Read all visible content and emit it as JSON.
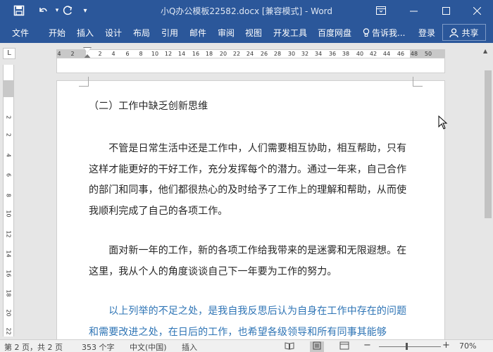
{
  "window": {
    "title": "小Q办公模板22582.docx [兼容模式] - Word",
    "minimize_icon": "minimize-icon",
    "restore_icon": "restore-icon",
    "close_icon": "close-icon"
  },
  "quick_access": {
    "save_icon": "save-icon",
    "undo_icon": "undo-icon",
    "redo_icon": "redo-icon",
    "customize_icon": "customize-toolbar-icon"
  },
  "ribbon": {
    "tabs": [
      "文件",
      "开始",
      "插入",
      "设计",
      "布局",
      "引用",
      "邮件",
      "审阅",
      "视图",
      "开发工具",
      "百度网盘"
    ],
    "tell_me": "告诉我...",
    "login": "登录",
    "share": "共享"
  },
  "ruler": {
    "tab_selector": "L",
    "numbers": [
      "4",
      "2",
      "2",
      "4",
      "6",
      "8",
      "10",
      "12",
      "14",
      "16",
      "18",
      "20",
      "22",
      "24",
      "26",
      "28",
      "30",
      "32",
      "34",
      "36",
      "38",
      "40",
      "42",
      "44",
      "46",
      "48",
      "50"
    ],
    "vertical_numbers": [
      "2",
      "2",
      "4",
      "6",
      "8",
      "10",
      "12",
      "14",
      "16",
      "18",
      "20",
      "22"
    ]
  },
  "document": {
    "heading": "（二）工作中缺乏创新思维",
    "paragraph1": "　　不管是日常生活中还是工作中，人们需要相互协助，相互帮助，只有这样才能更好的干好工作，充分发挥每个的潜力。通过一年来，自己合作的部门和同事，他们都很热心的及时给予了工作上的理解和帮助，从而使我顺利完成了自己的各项工作。",
    "paragraph2": "　　面对新一年的工作，新的各项工作给我带来的是迷雾和无限遐想。在这里，我从个人的角度谈谈自己下一年要为工作的努力。",
    "paragraph3": "　　以上列举的不足之处，是我自我反思后认为自身在工作中存在的问题和需要改进之处，在日后的工作，也希望各级领导和所有同事其能够"
  },
  "status": {
    "page": "第 2 页，共 2 页",
    "words": "353 个字",
    "language": "中文(中国)",
    "mode": "插入",
    "zoom_minus": "−",
    "zoom_plus": "+",
    "zoom": "70%"
  },
  "colors": {
    "brand": "#2b579a",
    "highlight_text": "#2e74b5"
  }
}
